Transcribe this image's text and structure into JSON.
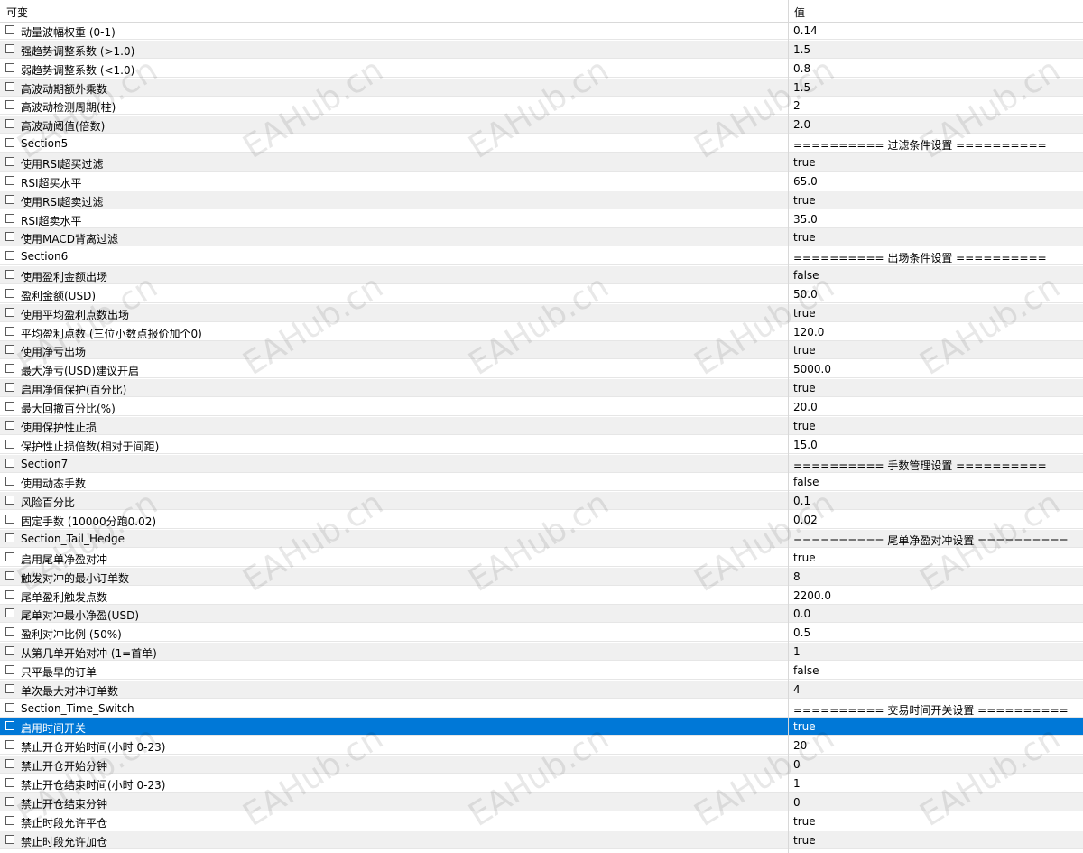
{
  "header": {
    "col_name": "可变",
    "col_value": "值"
  },
  "watermark": "EAHub.cn",
  "selected_index": 37,
  "rows": [
    {
      "name": "动量波幅权重 (0-1)",
      "value": "0.14"
    },
    {
      "name": "强趋势调整系数 (>1.0)",
      "value": "1.5"
    },
    {
      "name": "弱趋势调整系数 (<1.0)",
      "value": "0.8"
    },
    {
      "name": "高波动期额外乘数",
      "value": "1.5"
    },
    {
      "name": "高波动检测周期(柱)",
      "value": "2"
    },
    {
      "name": "高波动阈值(倍数)",
      "value": "2.0"
    },
    {
      "name": "Section5",
      "value": "========== 过滤条件设置 =========="
    },
    {
      "name": "使用RSI超买过滤",
      "value": "true"
    },
    {
      "name": "RSI超买水平",
      "value": "65.0"
    },
    {
      "name": "使用RSI超卖过滤",
      "value": "true"
    },
    {
      "name": "RSI超卖水平",
      "value": "35.0"
    },
    {
      "name": "使用MACD背离过滤",
      "value": "true"
    },
    {
      "name": "Section6",
      "value": "========== 出场条件设置 =========="
    },
    {
      "name": "使用盈利金额出场",
      "value": "false"
    },
    {
      "name": "盈利金额(USD)",
      "value": "50.0"
    },
    {
      "name": "使用平均盈利点数出场",
      "value": "true"
    },
    {
      "name": "平均盈利点数 (三位小数点报价加个0)",
      "value": "120.0"
    },
    {
      "name": "使用净亏出场",
      "value": "true"
    },
    {
      "name": "最大净亏(USD)建议开启",
      "value": "5000.0"
    },
    {
      "name": "启用净值保护(百分比)",
      "value": "true"
    },
    {
      "name": "最大回撤百分比(%)",
      "value": "20.0"
    },
    {
      "name": "使用保护性止损",
      "value": "true"
    },
    {
      "name": "保护性止损倍数(相对于间距)",
      "value": "15.0"
    },
    {
      "name": "Section7",
      "value": "========== 手数管理设置 =========="
    },
    {
      "name": "使用动态手数",
      "value": "false"
    },
    {
      "name": "风险百分比",
      "value": "0.1"
    },
    {
      "name": "固定手数 (10000分跑0.02)",
      "value": "0.02"
    },
    {
      "name": "Section_Tail_Hedge",
      "value": "========== 尾单净盈对冲设置 =========="
    },
    {
      "name": "启用尾单净盈对冲",
      "value": "true"
    },
    {
      "name": "触发对冲的最小订单数",
      "value": "8"
    },
    {
      "name": "尾单盈利触发点数",
      "value": "2200.0"
    },
    {
      "name": "尾单对冲最小净盈(USD)",
      "value": "0.0"
    },
    {
      "name": "盈利对冲比例 (50%)",
      "value": "0.5"
    },
    {
      "name": "从第几单开始对冲 (1=首单)",
      "value": "1"
    },
    {
      "name": "只平最早的订单",
      "value": "false"
    },
    {
      "name": "单次最大对冲订单数",
      "value": "4"
    },
    {
      "name": "Section_Time_Switch",
      "value": "========== 交易时间开关设置 =========="
    },
    {
      "name": "启用时间开关",
      "value": "true"
    },
    {
      "name": "禁止开仓开始时间(小时 0-23)",
      "value": "20"
    },
    {
      "name": "禁止开仓开始分钟",
      "value": "0"
    },
    {
      "name": "禁止开仓结束时间(小时 0-23)",
      "value": "1"
    },
    {
      "name": "禁止开仓结束分钟",
      "value": "0"
    },
    {
      "name": "禁止时段允许平仓",
      "value": "true"
    },
    {
      "name": "禁止时段允许加仓",
      "value": "true"
    }
  ]
}
